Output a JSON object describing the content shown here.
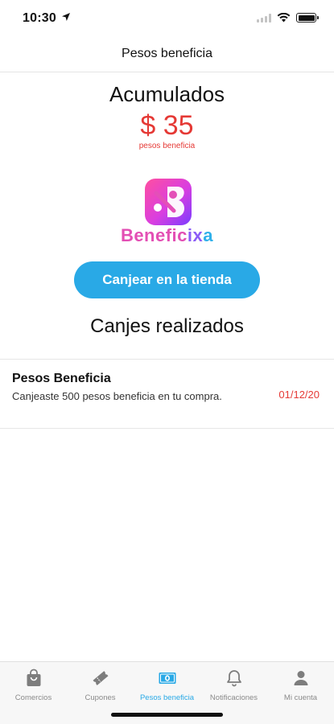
{
  "status_bar": {
    "time": "10:30"
  },
  "nav": {
    "title": "Pesos beneficia"
  },
  "summary": {
    "label": "Acumulados",
    "amount": "$ 35",
    "unit": "pesos beneficia"
  },
  "logo": {
    "text_part1": "Benefic",
    "text_part2": "i",
    "text_part3": "x",
    "text_part4": "a"
  },
  "redeem_button": {
    "label": "Canjear en la tienda"
  },
  "history": {
    "title": "Canjes realizados",
    "items": [
      {
        "title": "Pesos Beneficia",
        "description": "Canjeaste 500 pesos beneficia en tu compra.",
        "date": "01/12/20"
      }
    ]
  },
  "tabs": [
    {
      "label": "Comercios",
      "icon": "shopping-bag-icon",
      "active": false
    },
    {
      "label": "Cupones",
      "icon": "ticket-icon",
      "active": false
    },
    {
      "label": "Pesos beneficia",
      "icon": "banknote-icon",
      "active": true
    },
    {
      "label": "Notificaciones",
      "icon": "bell-icon",
      "active": false
    },
    {
      "label": "Mi cuenta",
      "icon": "user-icon",
      "active": false
    }
  ],
  "colors": {
    "accent": "#29a9e6",
    "amount": "#e53935",
    "inactive_tab": "#8a8a8a"
  }
}
